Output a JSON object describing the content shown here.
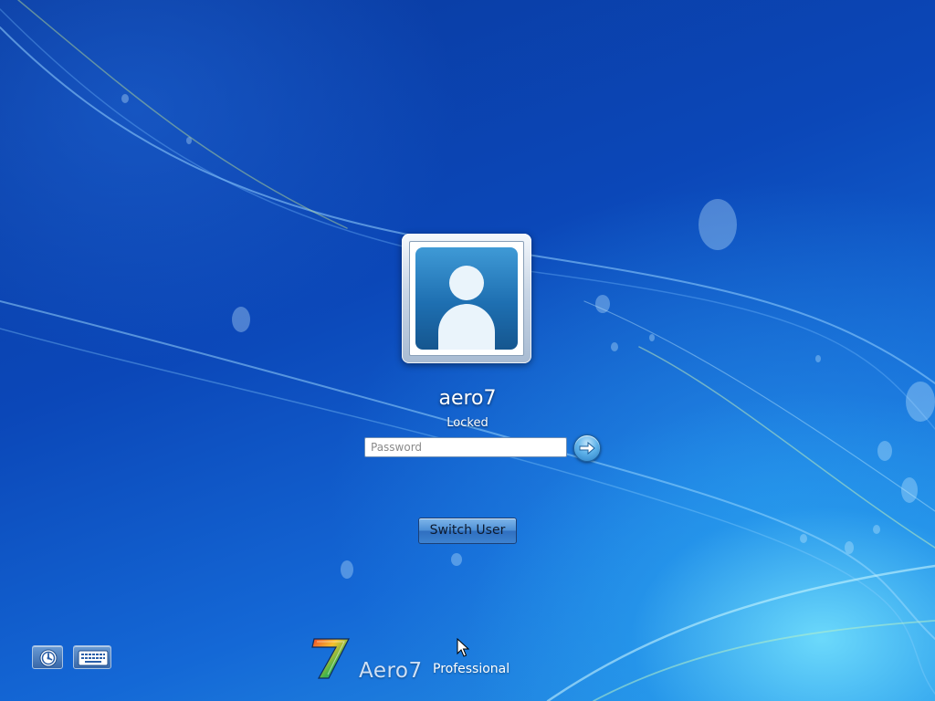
{
  "user": {
    "name": "aero7",
    "status": "Locked"
  },
  "login": {
    "password_placeholder": "Password",
    "password_value": ""
  },
  "actions": {
    "switch_user_label": "Switch User"
  },
  "bottom_bar": {
    "ease_of_access_icon": "ease-of-access-icon",
    "keyboard_icon": "on-screen-keyboard-icon"
  },
  "branding": {
    "product_name": "Aero7",
    "edition": "Professional"
  },
  "colors": {
    "background": "#0b47b8",
    "accent": "#3d82d0",
    "text": "#ffffff"
  }
}
